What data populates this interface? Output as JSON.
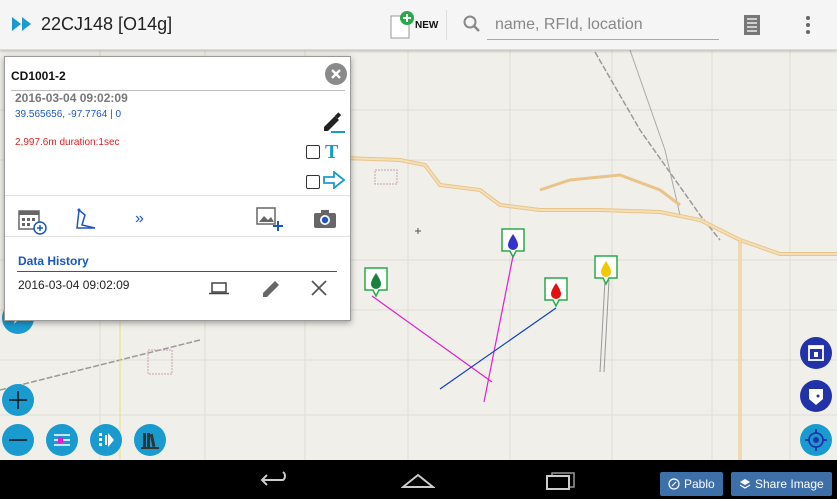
{
  "appbar": {
    "title": "22CJ148 [O14g]",
    "new_label": "NEW",
    "search_placeholder": "name, RFId, location"
  },
  "card": {
    "title": "CD1001-2",
    "datetime": "2016-03-04 09:02:09",
    "coordinates": "39.565656, -97.7764 | 0",
    "distance": "2,997.6m duration:1sec",
    "more_label": "»",
    "data_history_label": "Data History",
    "history_entries": [
      {
        "date": "2016-03-04 09:02:09"
      }
    ]
  },
  "navbar": {
    "user_label": "Pablo",
    "share_label": "Share Image"
  },
  "colors": {
    "accent": "#1a9bd0",
    "link_blue": "#1a56c4",
    "alert_red": "#e02020",
    "marker_blue": "#3333cc",
    "marker_red": "#e01010",
    "marker_yellow": "#f0c800",
    "marker_green": "#1a8040",
    "line_magenta": "#e020d0",
    "line_blue": "#1040c0",
    "fab_right": "#2233aa"
  }
}
